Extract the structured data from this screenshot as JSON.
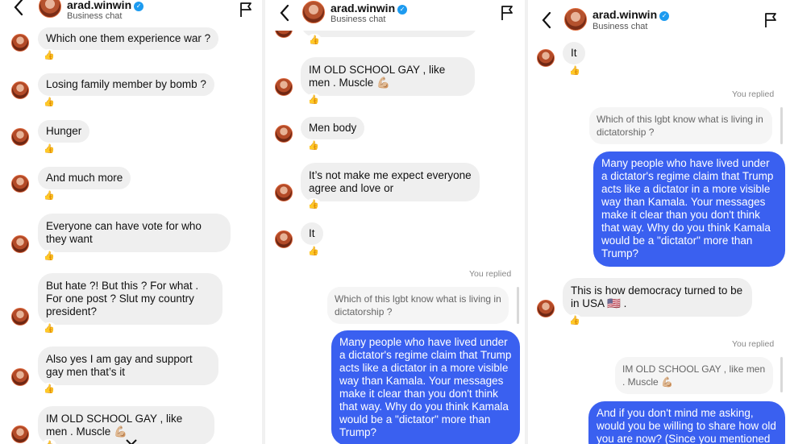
{
  "header": {
    "username": "arad.winwin",
    "subtitle": "Business chat",
    "verified_icon": "verified-badge-icon",
    "back_icon": "chevron-left-icon",
    "flag_icon": "flag-icon"
  },
  "reaction": "👍",
  "replied_label": "You replied",
  "colors": {
    "sent_bubble": "#3a60f0",
    "received_bubble": "#efefef",
    "verified": "#1d9bf0"
  },
  "panel1": {
    "messages": [
      "Which one them experience war ?",
      "Losing family member by bomb ?",
      "Hunger",
      "And much more",
      "Everyone can have vote for who they want",
      "But hate ?! But this ? For what . For one post ? Slut my country president?",
      "Also yes I am gay and support gay men that’s it",
      "IM OLD SCHOOL GAY , like men . Muscle 💪🏼"
    ]
  },
  "panel2": {
    "messages": [
      "IM OLD SCHOOL GAY , like men . Muscle 💪🏼",
      "Men body",
      "It’s not make me  expect everyone agree and love or",
      "It"
    ],
    "quoted": "Which of this lgbt know what is living in dictatorship ?",
    "sent": "Many people who have lived under a dictator's regime claim that Trump acts like a dictator in a more visible way than Kamala. Your messages make it clear than you don't think that way. Why do you think Kamala would be a \"dictator\" more than Trump?"
  },
  "panel3": {
    "messages": [
      "It",
      "This is how democracy turned to be in USA 🇺🇸 ."
    ],
    "quoted_1": "Which of this lgbt know what is living in dictatorship ?",
    "sent_1": "Many people who have lived under a dictator's regime claim that Trump acts like a dictator in a more visible way than Kamala. Your messages make it clear than you don't think that way. Why do you think Kamala would be a \"dictator\" more than Trump?",
    "quoted_2": "IM OLD SCHOOL GAY , like men . Muscle 💪🏼",
    "sent_2": "And if you don't mind me asking, would you be willing to share how old you are now? (Since you mentioned"
  }
}
